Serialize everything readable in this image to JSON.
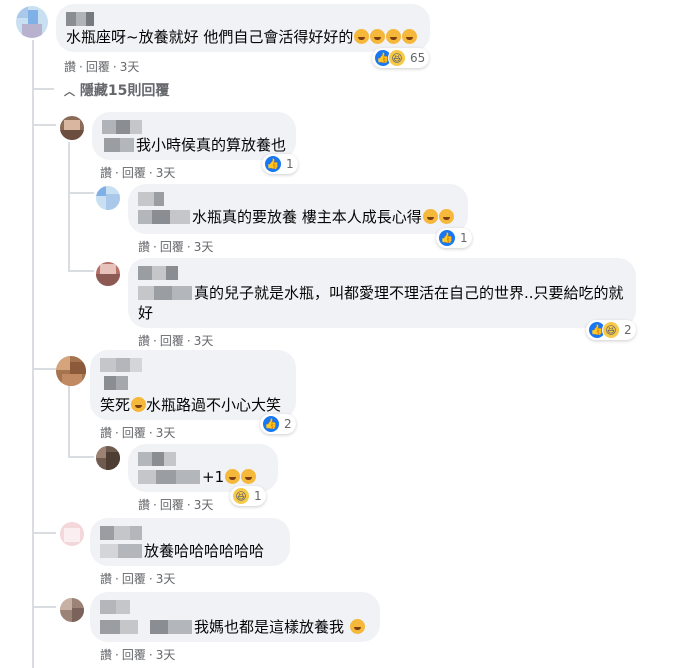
{
  "comments": [
    {
      "text": "水瓶座呀~放養就好 他們自己會活得好好的",
      "actions": {
        "like": "讚",
        "reply": "回覆",
        "time": "3天"
      },
      "reactions": {
        "types": [
          "like",
          "haha"
        ],
        "count": "65"
      }
    },
    {
      "text": "我小時侯真的算放養也",
      "actions": {
        "like": "讚",
        "reply": "回覆",
        "time": "3天"
      },
      "reactions": {
        "types": [
          "like"
        ],
        "count": "1"
      }
    },
    {
      "text": "水瓶真的要放養 樓主本人成長心得",
      "actions": {
        "like": "讚",
        "reply": "回覆",
        "time": "3天"
      },
      "reactions": {
        "types": [
          "like"
        ],
        "count": "1"
      }
    },
    {
      "text_line1": "真的兒子就是水瓶，叫都愛理不理活在自己的世界..只要給吃的就",
      "text_line2": "好",
      "actions": {
        "like": "讚",
        "reply": "回覆",
        "time": "3天"
      },
      "reactions": {
        "types": [
          "like",
          "haha"
        ],
        "count": "2"
      }
    },
    {
      "text_prefix": "笑死",
      "text": "水瓶路過不小心大笑",
      "actions": {
        "like": "讚",
        "reply": "回覆",
        "time": "3天"
      },
      "reactions": {
        "types": [
          "like"
        ],
        "count": "2"
      }
    },
    {
      "text": "+1",
      "actions": {
        "like": "讚",
        "reply": "回覆",
        "time": "3天"
      },
      "reactions": {
        "types": [
          "haha"
        ],
        "count": "1"
      }
    },
    {
      "text": "放養哈哈哈哈哈哈",
      "actions": {
        "like": "讚",
        "reply": "回覆",
        "time": "3天"
      }
    },
    {
      "text": "我媽也都是這樣放養我",
      "actions": {
        "like": "讚",
        "reply": "回覆",
        "time": "3天"
      }
    }
  ],
  "hide_replies": "隱藏15則回覆",
  "colors": {
    "like": "#1877f2",
    "haha": "#f7c948",
    "bubble": "#f0f2f5",
    "meta": "#65676b"
  }
}
